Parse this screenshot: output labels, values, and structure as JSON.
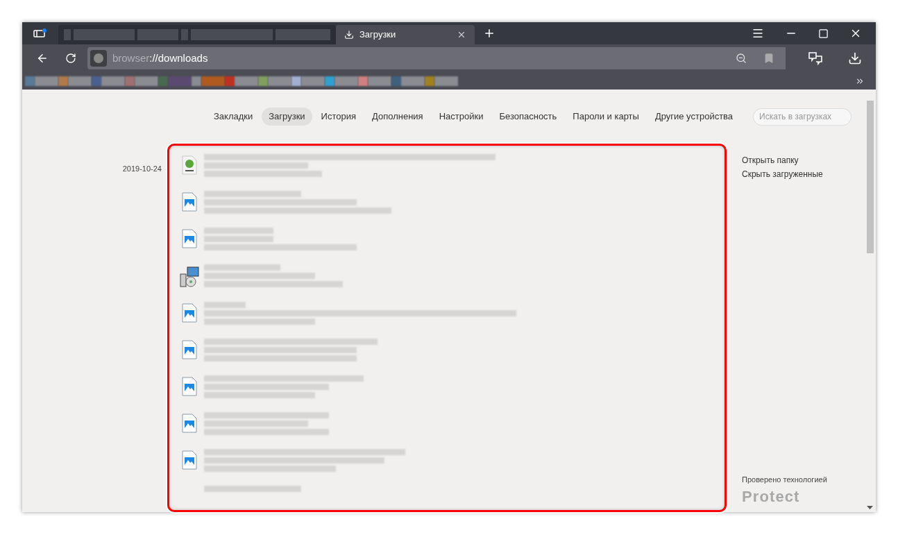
{
  "window": {
    "tabs": [
      {
        "title": "Загрузки",
        "selected": true
      }
    ]
  },
  "address_bar": {
    "scheme": "browser",
    "rest": "://downloads"
  },
  "nav": [
    {
      "label": "Закладки",
      "selected": false
    },
    {
      "label": "Загрузки",
      "selected": true
    },
    {
      "label": "История",
      "selected": false
    },
    {
      "label": "Дополнения",
      "selected": false
    },
    {
      "label": "Настройки",
      "selected": false
    },
    {
      "label": "Безопасность",
      "selected": false
    },
    {
      "label": "Пароли и карты",
      "selected": false
    },
    {
      "label": "Другие устройства",
      "selected": false
    }
  ],
  "search": {
    "placeholder": "Искать в загрузках"
  },
  "downloads": {
    "date": "2019-10-24",
    "items": [
      {
        "kind": "torrent"
      },
      {
        "kind": "image"
      },
      {
        "kind": "image"
      },
      {
        "kind": "installer"
      },
      {
        "kind": "image"
      },
      {
        "kind": "image"
      },
      {
        "kind": "image"
      },
      {
        "kind": "image"
      },
      {
        "kind": "image"
      },
      {
        "kind": "none"
      }
    ]
  },
  "actions": [
    "Открыть папку",
    "Скрыть загруженные"
  ],
  "footer": {
    "note": "Проверено технологией",
    "brand": "Protect"
  }
}
